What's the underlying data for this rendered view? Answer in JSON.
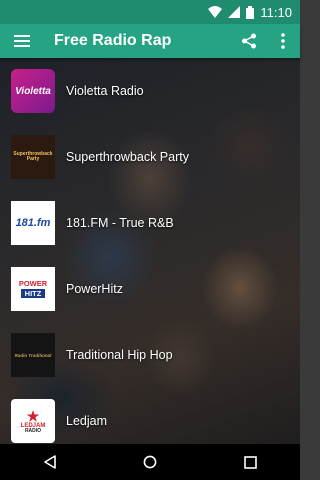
{
  "status_bar": {
    "time": "11:10"
  },
  "app_bar": {
    "title": "Free Radio Rap"
  },
  "stations": [
    {
      "name": "Violetta Radio",
      "logo_text": "Violetta"
    },
    {
      "name": "Superthrowback Party",
      "logo_text": "Superthrowback Party"
    },
    {
      "name": "181.FM - True R&B",
      "logo_text": "181.fm"
    },
    {
      "name": "PowerHitz",
      "logo_line1": "POWER",
      "logo_line2": "HITZ"
    },
    {
      "name": "Traditional Hip Hop",
      "logo_text": "Radio Traditional"
    },
    {
      "name": "Ledjam",
      "logo_line1": "LEDJAM",
      "logo_line2": "RADIO"
    }
  ],
  "colors": {
    "status_bar": "#1f8c70",
    "app_bar": "#26a383",
    "nav_bar": "#000000"
  },
  "icons": {
    "menu": "hamburger-icon",
    "share": "share-icon",
    "overflow": "more-vert-icon",
    "back": "back-triangle-icon",
    "home": "home-circle-icon",
    "recents": "recents-square-icon"
  }
}
